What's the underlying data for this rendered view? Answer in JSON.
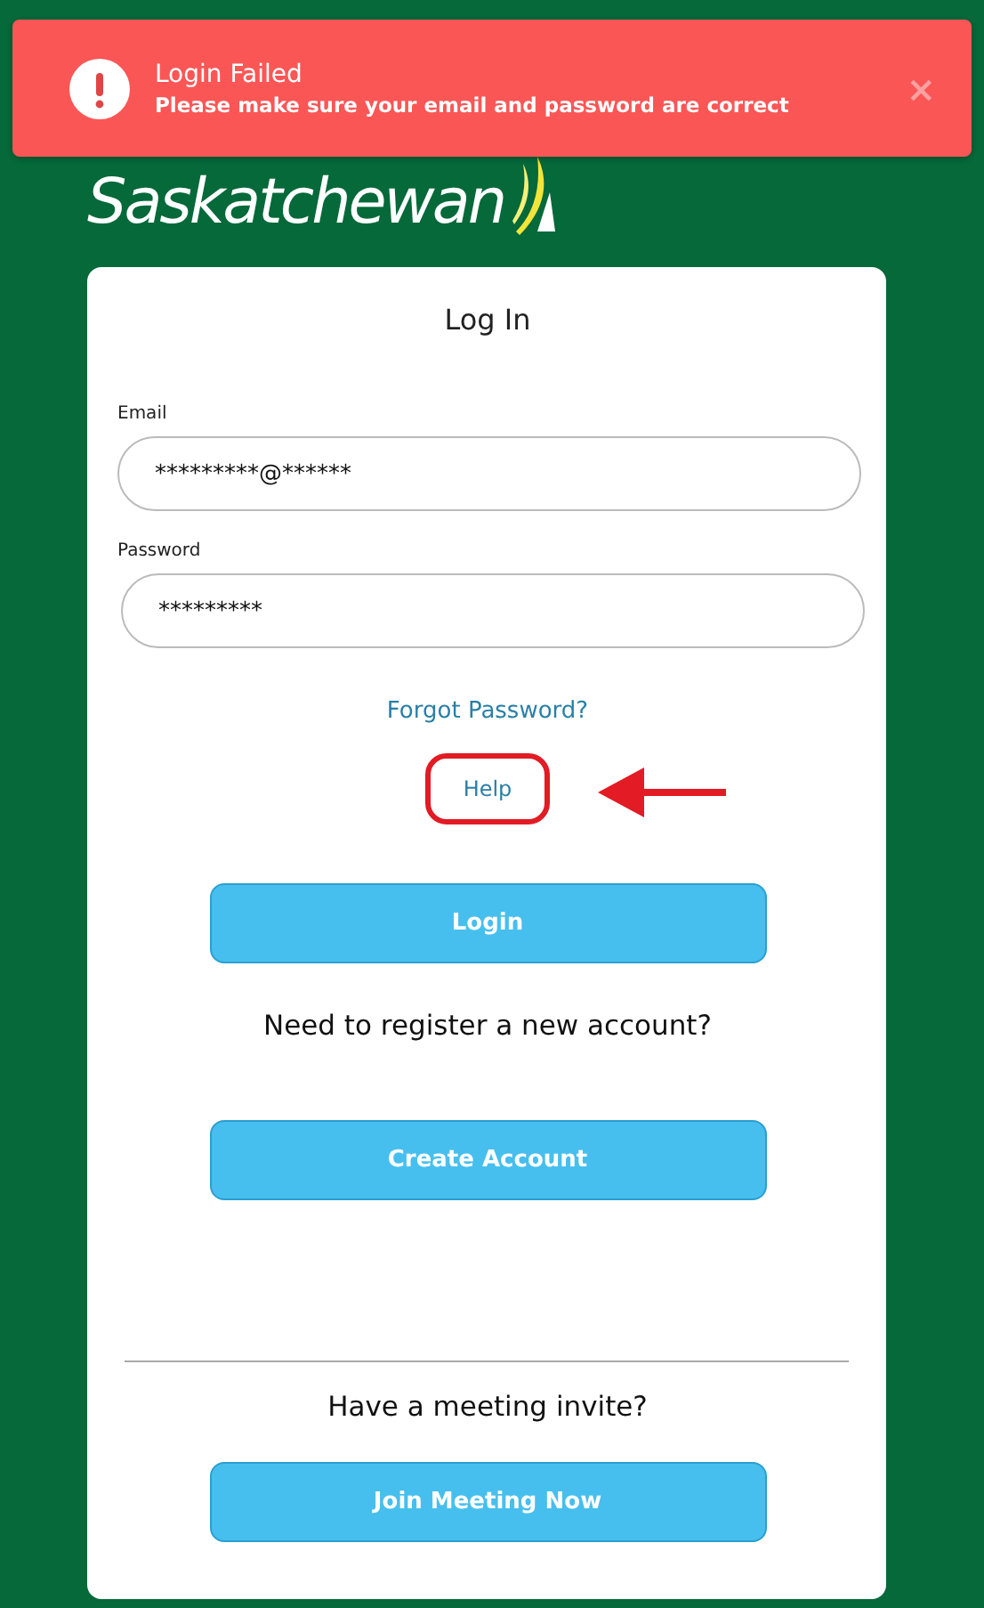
{
  "toast": {
    "title": "Login Failed",
    "message": "Please make sure your email and password are correct",
    "close": "×"
  },
  "logo": {
    "text": "Saskatchewan"
  },
  "card": {
    "title": "Log In",
    "fields": [
      {
        "label": "Email",
        "value": "*********@******"
      },
      {
        "label": "Password",
        "value": "*********"
      }
    ],
    "links": [
      {
        "label": "Forgot Password?",
        "highlighted": false
      },
      {
        "label": "Help",
        "highlighted": true
      }
    ],
    "sections": [
      {
        "button": "Login",
        "divider": false
      },
      {
        "heading": "Need to register a new account?",
        "button": "Create Account",
        "divider": false
      },
      {
        "heading": "Have a meeting invite?",
        "button": "Join Meeting Now",
        "divider": true
      }
    ]
  }
}
